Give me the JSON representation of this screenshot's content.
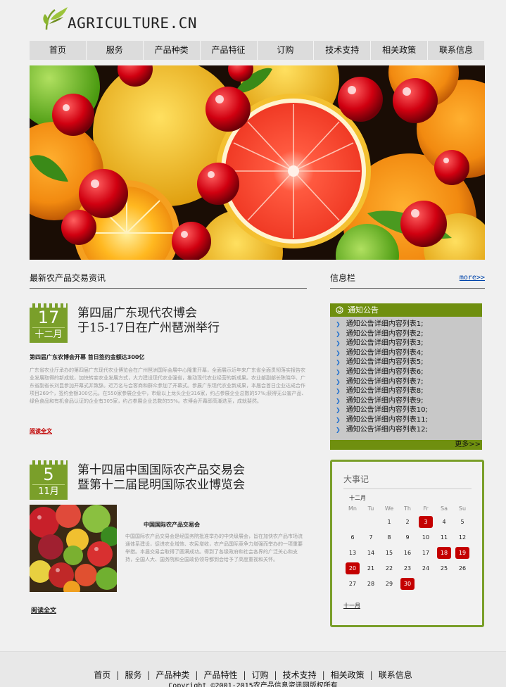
{
  "header": {
    "logo_text": "AGRICULTURE.CN"
  },
  "nav": {
    "items": [
      "首页",
      "服务",
      "产品种类",
      "产品特征",
      "订购",
      "技术支持",
      "相关政策",
      "联系信息"
    ]
  },
  "main": {
    "section_title": "最新农产品交易资讯",
    "news": [
      {
        "day": "17",
        "month": "十二月",
        "title_line1": "第四届广东现代农博会",
        "title_line2": "于15-17日在广州琶洲举行",
        "subtitle": "第四届广东农博会开幕 首日签约金额达300亿",
        "body": "广东省农业厅承办的第四届广东现代农业博览会在广州琶洲国际会展中心隆重开幕，全面展示近年来广东省全面贯彻落实报告农业发展取得的新成就，加快转变农业发展方式，大力建设现代农业强省，推动现代农业经营的新成果。农业部副部长陈晓华、广东省副省长刘昆参加开幕式并致辞。近万名与会客商和群众参加了开幕式。参展广东现代农业新成果，本届会首日企业达成合作项目269个，签约金额300亿元。在550家参展企业中，市级以上龙头企业316家，约占参展企业总数的57%;获得无公害产品、绿色食品和有机食品认证的企业有305家，约占参展企业总数的55%。农博会开幕即高潮迭至，成就斐然。",
        "read_more": "阅读全文"
      },
      {
        "day": "5",
        "month": "11月",
        "title_line1": "第十四届中国国际农产品交易会",
        "title_line2": "暨第十二届昆明国际农业博览会",
        "subtitle": "中国国际农产品交易会",
        "body": "中国国际农产品交易会是经国务院批准举办的中央级展会，旨在加快农产品市场流通体系建设，促进农业增效、农民增收，农产品国际竞争力增强而举办的一项重要举措。本届交易会取得了圆满成功。得到了各级政府和社会各界的广泛关心和支持，全国人大、国务院和全国政协领导都到会给予了高度重视和关怀。",
        "read_more": "阅读全文"
      }
    ]
  },
  "sidebar": {
    "title": "信息栏",
    "more": "more>>",
    "notice": {
      "title": "通知公告",
      "items": [
        "通知公告详细内容列表1;",
        "通知公告详细内容列表2;",
        "通知公告详细内容列表3;",
        "通知公告详细内容列表4;",
        "通知公告详细内容列表5;",
        "通知公告详细内容列表6;",
        "通知公告详细内容列表7;",
        "通知公告详细内容列表8;",
        "通知公告详细内容列表9;",
        "通知公告详细内容列表10;",
        "通知公告详细内容列表11;",
        "通知公告详细内容列表12;"
      ],
      "more": "更多>>"
    },
    "calendar": {
      "title": "大事记",
      "month": "十二月",
      "weekdays": [
        "Mn",
        "Tu",
        "We",
        "Th",
        "Fr",
        "Sa",
        "Su"
      ],
      "weeks": [
        [
          "",
          "",
          "1",
          "2",
          "3",
          "4",
          "5"
        ],
        [
          "6",
          "7",
          "8",
          "9",
          "10",
          "11",
          "12"
        ],
        [
          "13",
          "14",
          "15",
          "16",
          "17",
          "18",
          "19"
        ],
        [
          "20",
          "21",
          "22",
          "23",
          "24",
          "25",
          "26"
        ],
        [
          "27",
          "28",
          "29",
          "30",
          "",
          "",
          ""
        ]
      ],
      "highlighted": [
        "3",
        "18",
        "19",
        "20",
        "30"
      ],
      "prev_month": "十一月"
    }
  },
  "footer": {
    "links": [
      "首页",
      "服务",
      "产品种类",
      "产品特性",
      "订购",
      "技术支持",
      "相关政策",
      "联系信息"
    ],
    "copyright": "Copyright ©2001-2015农产品信息资讯网版权所有"
  },
  "colors": {
    "accent_green": "#7a9f2a",
    "highlight_red": "#c40000",
    "nav_gray": "#dcdcdc"
  }
}
